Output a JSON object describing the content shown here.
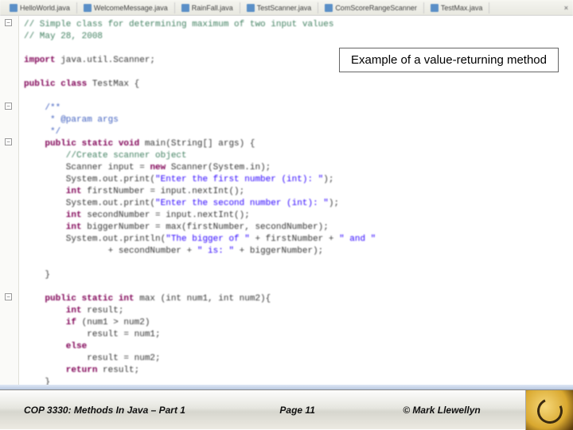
{
  "tabs": [
    {
      "label": "HelloWorld.java"
    },
    {
      "label": "WelcomeMessage.java"
    },
    {
      "label": "RainFall.java"
    },
    {
      "label": "TestScanner.java"
    },
    {
      "label": "ComScoreRangeScanner"
    },
    {
      "label": "TestMax.java"
    }
  ],
  "callout": "Example of a value-returning method",
  "code": {
    "l1": "// Simple class for determining maximum of two input values",
    "l2": "// May 28, 2008",
    "l3": "",
    "l4a": "import",
    "l4b": " java.util.Scanner;",
    "l5": "",
    "l6a": "public class",
    "l6b": " TestMax {",
    "l7": "",
    "l8": "    /**",
    "l9": "     * @param args",
    "l10": "     */",
    "l11a": "    public static void",
    "l11b": " main(String[] args) {",
    "l12": "        //Create scanner object",
    "l13a": "        Scanner input = ",
    "l13k": "new",
    "l13b": " Scanner(System.in);",
    "l14a": "        System.out.print(",
    "l14s": "\"Enter the first number (int): \"",
    "l14b": ");",
    "l15a": "        int",
    "l15b": " firstNumber = input.nextInt();",
    "l16a": "        System.out.print(",
    "l16s": "\"Enter the second number (int): \"",
    "l16b": ");",
    "l17a": "        int",
    "l17b": " secondNumber = input.nextInt();",
    "l18a": "        int",
    "l18b": " biggerNumber = max(firstNumber, secondNumber);",
    "l19a": "        System.out.println(",
    "l19s": "\"The bigger of \"",
    "l19b": " + firstNumber + ",
    "l19s2": "\" and \"",
    "l20a": "                + secondNumber + ",
    "l20s": "\" is: \"",
    "l20b": " + biggerNumber);",
    "l21": "",
    "l22": "    }",
    "l23": "",
    "l24a": "    public static int",
    "l24b": " max (int num1, int num2){",
    "l25a": "        int",
    "l25b": " result;",
    "l26a": "        if",
    "l26b": " (num1 > num2)",
    "l27": "            result = num1;",
    "l28a": "        else",
    "l29": "            result = num2;",
    "l30a": "        return",
    "l30b": " result;",
    "l31": "    }",
    "l32": "}"
  },
  "footer": {
    "left": "COP 3330:  Methods In Java – Part 1",
    "mid": "Page 11",
    "right": "© Mark Llewellyn"
  }
}
